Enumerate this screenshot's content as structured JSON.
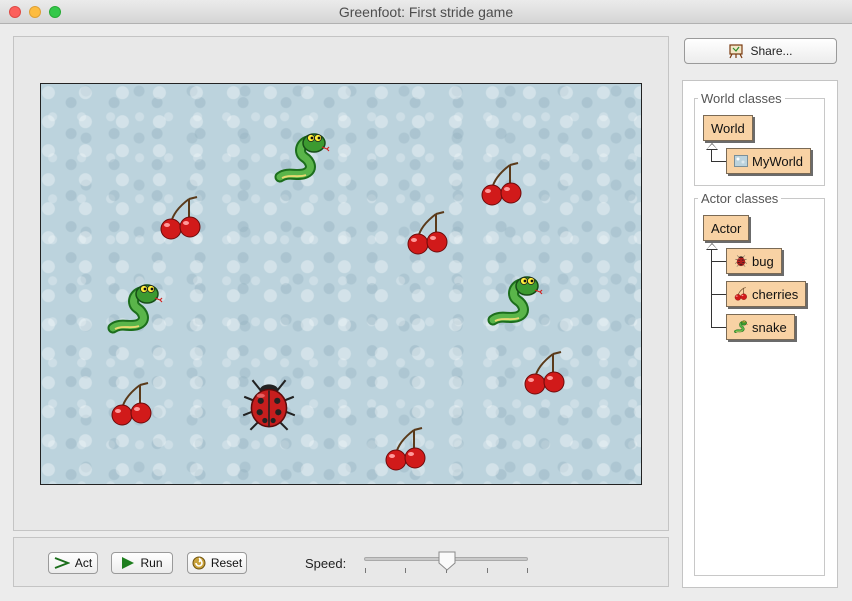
{
  "window": {
    "title": "Greenfoot: First stride game"
  },
  "world": {
    "actors": [
      {
        "type": "snake",
        "icon": "snake-icon"
      },
      {
        "type": "snake",
        "icon": "snake-icon"
      },
      {
        "type": "snake",
        "icon": "snake-icon"
      },
      {
        "type": "cherries",
        "icon": "cherries-icon"
      },
      {
        "type": "cherries",
        "icon": "cherries-icon"
      },
      {
        "type": "cherries",
        "icon": "cherries-icon"
      },
      {
        "type": "cherries",
        "icon": "cherries-icon"
      },
      {
        "type": "cherries",
        "icon": "cherries-icon"
      },
      {
        "type": "cherries",
        "icon": "cherries-icon"
      },
      {
        "type": "bug",
        "icon": "ladybug-icon"
      }
    ]
  },
  "controls": {
    "act_label": "Act",
    "run_label": "Run",
    "reset_label": "Reset",
    "speed_label": "Speed:",
    "speed_value": 0.5
  },
  "share": {
    "label": "Share..."
  },
  "classes": {
    "world_title": "World classes",
    "world": "World",
    "myworld": "MyWorld",
    "actor_title": "Actor classes",
    "actor": "Actor",
    "bug": "bug",
    "cherries": "cherries",
    "snake": "snake"
  },
  "colors": {
    "class_box": "#f8d2a4",
    "world_background": "#bcd3dd"
  }
}
